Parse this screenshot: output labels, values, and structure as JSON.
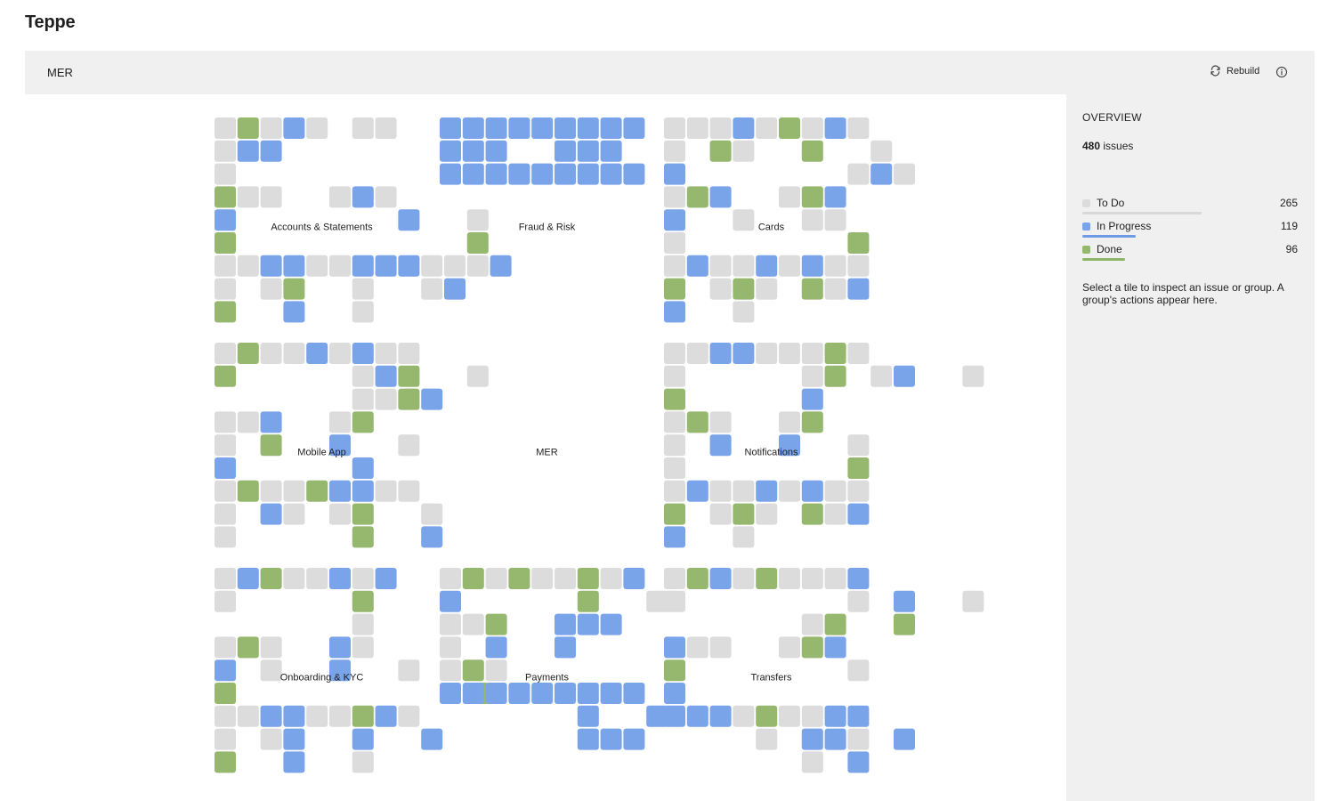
{
  "app": {
    "title": "Teppe"
  },
  "toolbar": {
    "title": "MER",
    "rebuild_label": "Rebuild",
    "rebuild_icon": "refresh-icon",
    "info_icon": "info-icon"
  },
  "colors": {
    "todo": "#dcdcdc",
    "in_progress": "#79a4e9",
    "done": "#96b86e",
    "canvas": "#ffffff",
    "panel": "#f0f0f0"
  },
  "treemap": {
    "root": "MER",
    "groups": [
      {
        "name": "Accounts & Statements",
        "rows": [
          "TDTIT.TT",
          "TII",
          "T",
          "DTT..TIT",
          "I.......I..T",
          "D..........D",
          "TTIITTIIITTTI......",
          "T.TD..T..TI",
          "D..I..T"
        ]
      },
      {
        "name": "Fraud & Risk",
        "rows": [
          "IIIIIIIII",
          "III..III",
          "IIIIIIIII"
        ]
      },
      {
        "name": "Cards",
        "rows": [
          "TTTITDTIT",
          "T.DT..D..T",
          "I.......TIT",
          "TDI..TDI",
          "I..T..TT",
          "T.......D",
          "TITTITITT",
          "D.TDT.DTI",
          "I..T"
        ]
      },
      {
        "name": "Mobile App",
        "rows": [
          "TDTTITITT",
          "D.....TID..T",
          "......TTDI",
          "TTI..TD",
          "T.D..I..T",
          "I.....I",
          "TDTTDIITT",
          "T.IT.TD..T",
          "T.....D..I"
        ]
      },
      {
        "name": "Notifications",
        "rows": [
          "TTIITTTDT",
          "T.....TD.TI..T",
          "D.....I",
          "TDT..TD",
          "T.I..I..T",
          "T.......D",
          "TITTITITT",
          "D.TDT.DTI",
          "I..T"
        ]
      },
      {
        "name": "Onboarding & KYC",
        "rows": [
          "TIDTTITI",
          "T.....D",
          "......T",
          "TDT..IT",
          "I.T..I..T",
          "D..........D",
          "TTIITTDIT",
          "T.TI..I..I",
          "D..I..T"
        ]
      },
      {
        "name": "Payments",
        "rows": [
          "TDTDTTDTI",
          "I.....D..T",
          "TTD..III",
          "T.I..I",
          "TDT",
          "IIIIIIIII",
          "......I..I",
          "......III"
        ]
      },
      {
        "name": "Transfers",
        "rows": [
          "TDITDTTTI",
          "T.......T.I..T",
          "......TD..D",
          "ITT..TDI",
          "D.......T",
          "I",
          "IIITDTTII",
          "....T.IIT.I",
          "......T.I"
        ]
      }
    ]
  },
  "overview": {
    "heading": "OVERVIEW",
    "total_count": "480",
    "total_suffix": "issues",
    "statuses": [
      {
        "label": "To Do",
        "value": "265",
        "fraction": 0.552,
        "color": "#dcdcdc",
        "bar_color": "#d8d8d8"
      },
      {
        "label": "In Progress",
        "value": "119",
        "fraction": 0.248,
        "color": "#79a4e9",
        "bar_color": "#6f9be6"
      },
      {
        "label": "Done",
        "value": "96",
        "fraction": 0.2,
        "color": "#96b86e",
        "bar_color": "#8db566"
      }
    ],
    "hint": "Select a tile to inspect an issue or group. A group's actions appear here."
  }
}
